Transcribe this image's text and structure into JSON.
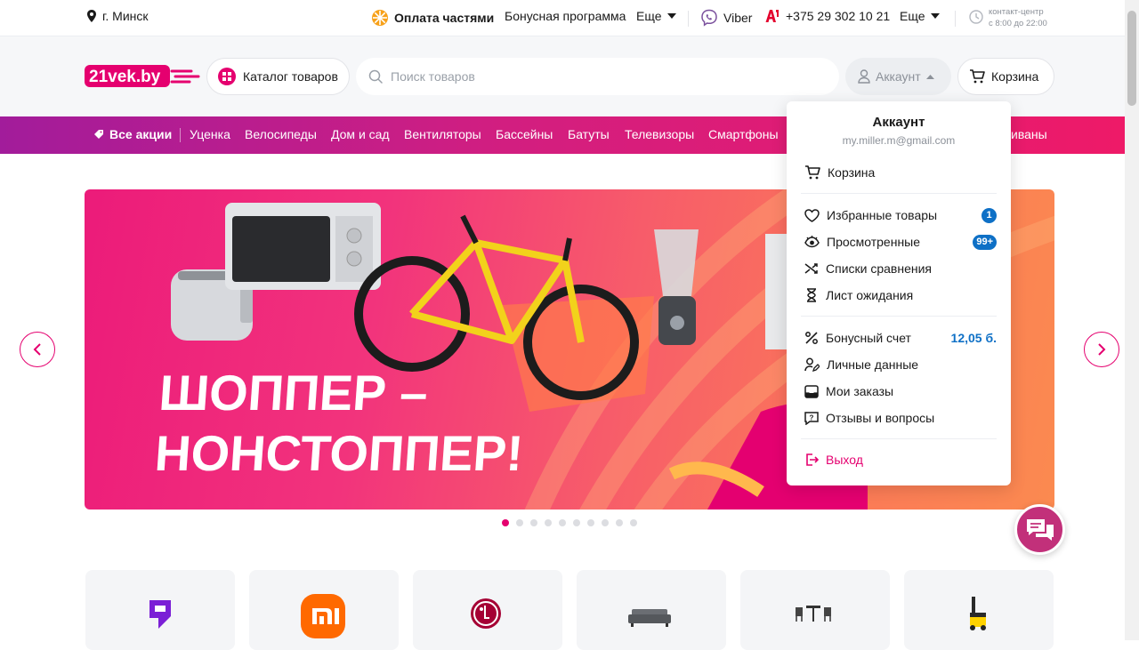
{
  "topbar": {
    "city": "г. Минск",
    "installments": "Оплата частями",
    "bonus_program": "Бонусная программа",
    "more1": "Еще",
    "viber": "Viber",
    "phone": "+375 29 302 10 21",
    "more2": "Еще",
    "contact_center": "контакт-центр",
    "hours": "с 8:00 до 22:00"
  },
  "header": {
    "logo": "21vek.by",
    "catalog": "Каталог товаров",
    "search_placeholder": "Поиск товаров",
    "account": "Аккаунт",
    "cart": "Корзина"
  },
  "nav": {
    "items": [
      "Все акции",
      "Уценка",
      "Велосипеды",
      "Дом и сад",
      "Вентиляторы",
      "Бассейны",
      "Батуты",
      "Телевизоры",
      "Смартфоны",
      "иваны"
    ]
  },
  "banner": {
    "line1": "ШОППЕР –",
    "line2": "НОНСТОППЕР!"
  },
  "carousel": {
    "dot_count": 10,
    "active_index": 0
  },
  "account_menu": {
    "title": "Аккаунт",
    "email": "my.miller.m@gmail.com",
    "cart": "Корзина",
    "favorites": "Избранные товары",
    "favorites_count": "1",
    "viewed": "Просмотренные",
    "viewed_count": "99+",
    "compare": "Списки сравнения",
    "waitlist": "Лист ожидания",
    "bonus": "Бонусный счет",
    "bonus_value": "12,05 б.",
    "personal": "Личные данные",
    "orders": "Мои заказы",
    "reviews": "Отзывы и вопросы",
    "logout": "Выход"
  },
  "colors": {
    "brand": "#e5006f",
    "badge": "#0e70c6",
    "nav_start": "#a21c9b",
    "nav_end": "#ee1a68"
  }
}
